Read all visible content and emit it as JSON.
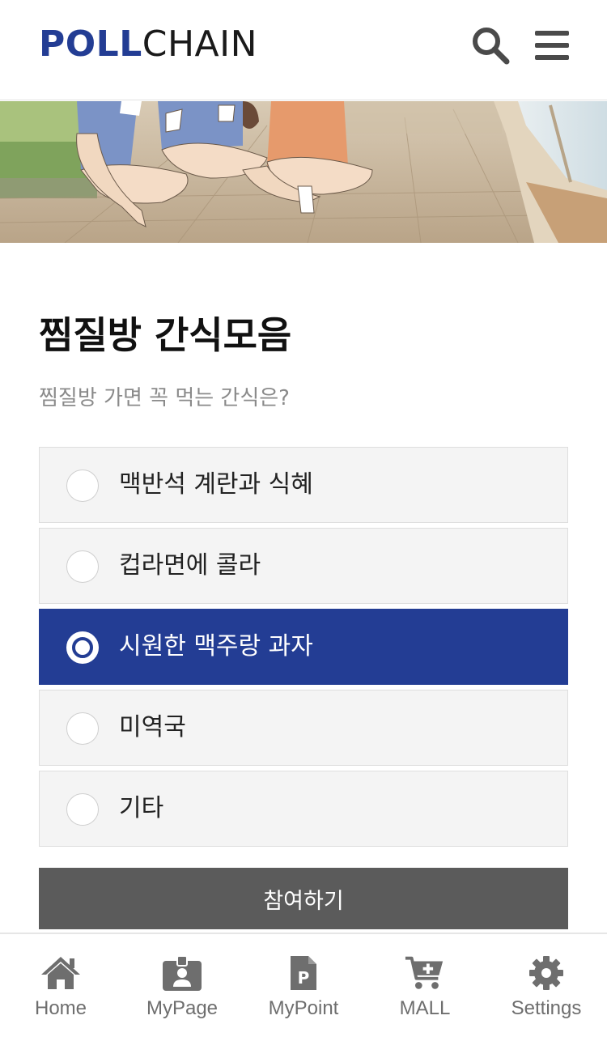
{
  "header": {
    "logo_bold": "POLL",
    "logo_light": "CHAIN",
    "search_icon": "search-icon",
    "menu_icon": "hamburger-menu-icon",
    "brand_color": "#233d94"
  },
  "banner": {
    "description_icon": "jjimjilbang-banner-illustration"
  },
  "poll": {
    "title": "찜질방 간식모음",
    "question": "찜질방 가면 꼭 먹는 간식은?",
    "options": [
      {
        "label": "맥반석 계란과 식혜",
        "selected": false
      },
      {
        "label": "컵라면에 콜라",
        "selected": false
      },
      {
        "label": "시원한 맥주랑 과자",
        "selected": true
      },
      {
        "label": "미역국",
        "selected": false
      },
      {
        "label": "기타",
        "selected": false
      }
    ],
    "submit_label": "참여하기",
    "selected_color": "#233d94"
  },
  "bottom_nav": {
    "items": [
      {
        "label": "Home",
        "icon": "home-icon"
      },
      {
        "label": "MyPage",
        "icon": "id-badge-icon"
      },
      {
        "label": "MyPoint",
        "icon": "point-document-icon"
      },
      {
        "label": "MALL",
        "icon": "cart-plus-icon"
      },
      {
        "label": "Settings",
        "icon": "gear-icon"
      }
    ]
  }
}
